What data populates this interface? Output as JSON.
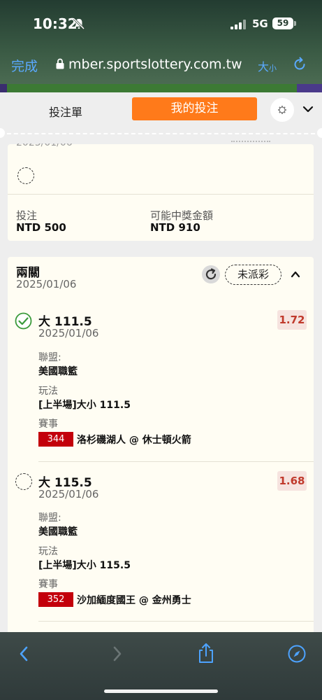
{
  "status_bar": {
    "time": "10:32",
    "network": "5G",
    "battery": "59"
  },
  "browser": {
    "done_label": "完成",
    "url": "mber.sportslottery.com.tw",
    "text_size_big": "大",
    "text_size_small": "小"
  },
  "tabs": {
    "bet_slip": "投注單",
    "my_bets": "我的投注"
  },
  "card1": {
    "date_partial": "2025/01/06",
    "stake_label": "投注",
    "stake_value": "NTD 500",
    "payout_label": "可能中獎金額",
    "payout_value": "NTD 910"
  },
  "card2": {
    "title": "兩關",
    "date": "2025/01/06",
    "status": "未派彩",
    "selections": [
      {
        "title": "大 111.5",
        "date": "2025/01/06",
        "odds": "1.72",
        "league_label": "聯盟:",
        "league": "美國職籃",
        "market_label": "玩法",
        "market": "[上半場]大小 111.5",
        "event_label": "賽事",
        "game_no": "344",
        "game": "洛杉磯湖人 @ 休士頓火箭",
        "status": "won"
      },
      {
        "title": "大 115.5",
        "date": "2025/01/06",
        "odds": "1.68",
        "league_label": "聯盟:",
        "league": "美國職籃",
        "market_label": "玩法",
        "market": "[上半場]大小 115.5",
        "event_label": "賽事",
        "game_no": "352",
        "game": "沙加緬度國王 @ 金州勇士",
        "status": "pending"
      }
    ]
  },
  "colors": {
    "accent": "#ff7a1a",
    "odds_text": "#c0392b",
    "game_badge": "#c3000b",
    "ios_link": "#5aa9ff"
  },
  "icons": [
    "bell-slash-icon",
    "lock-icon",
    "reload-icon",
    "gear-icon",
    "chevron-down-icon",
    "refresh-icon",
    "chevron-up-icon",
    "check-circle-icon",
    "back-icon",
    "forward-icon",
    "share-icon",
    "compass-icon"
  ]
}
